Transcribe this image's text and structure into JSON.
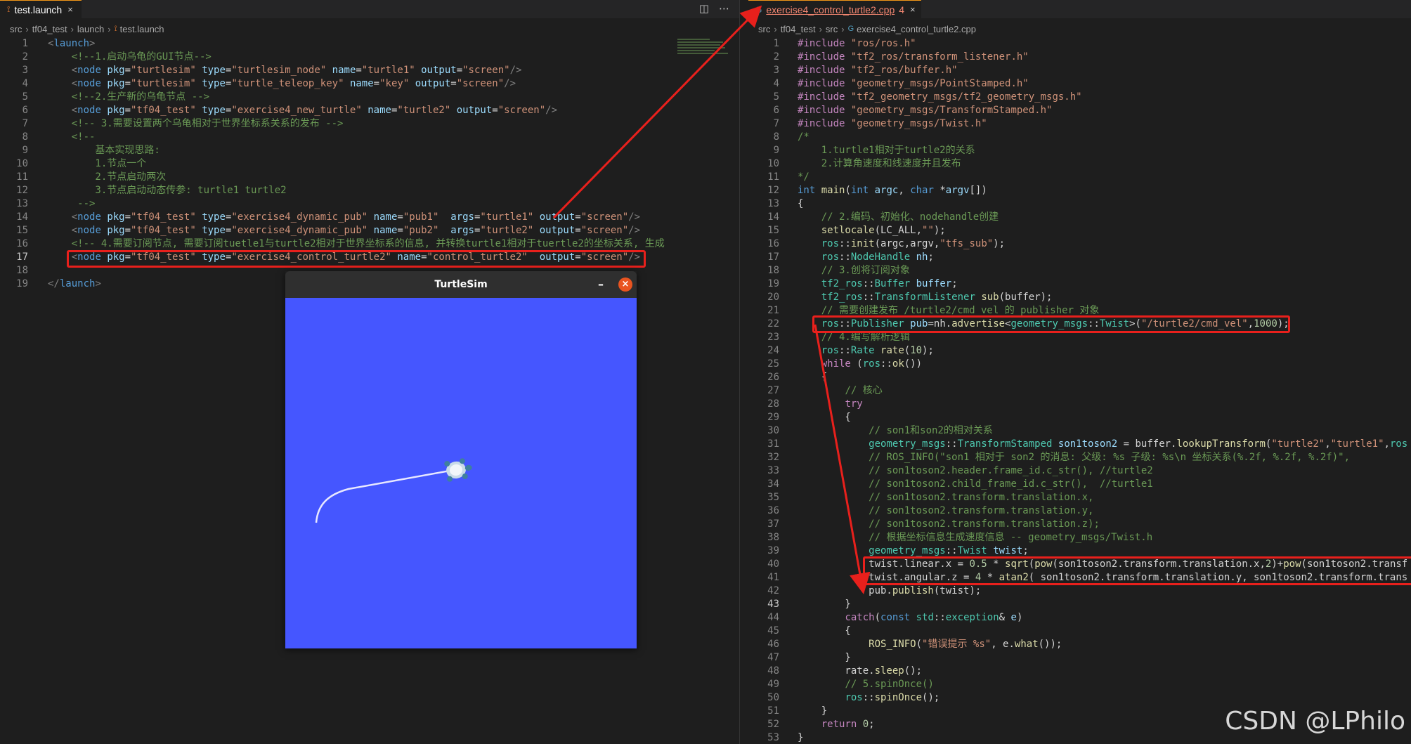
{
  "left_editor": {
    "tab": {
      "label": "test.launch",
      "close": "×"
    },
    "breadcrumb": [
      "src",
      "tf04_test",
      "launch",
      "test.launch"
    ],
    "current_line": 17,
    "lines": [
      {
        "n": 1,
        "html": "<span class='c-pun'>&lt;</span><span class='c-tag'>launch</span><span class='c-pun'>&gt;</span>"
      },
      {
        "n": 2,
        "html": "    <span class='c-com'>&lt;!--1.启动乌龟的GUI节点--&gt;</span>"
      },
      {
        "n": 3,
        "html": "    <span class='c-pun'>&lt;</span><span class='c-tag'>node</span> <span class='c-attr'>pkg</span>=<span class='c-str'>\"turtlesim\"</span> <span class='c-attr'>type</span>=<span class='c-str'>\"turtlesim_node\"</span> <span class='c-attr'>name</span>=<span class='c-str'>\"turtle1\"</span> <span class='c-attr'>output</span>=<span class='c-str'>\"screen\"</span><span class='c-pun'>/&gt;</span>"
      },
      {
        "n": 4,
        "html": "    <span class='c-pun'>&lt;</span><span class='c-tag'>node</span> <span class='c-attr'>pkg</span>=<span class='c-str'>\"turtlesim\"</span> <span class='c-attr'>type</span>=<span class='c-str'>\"turtle_teleop_key\"</span> <span class='c-attr'>name</span>=<span class='c-str'>\"key\"</span> <span class='c-attr'>output</span>=<span class='c-str'>\"screen\"</span><span class='c-pun'>/&gt;</span>"
      },
      {
        "n": 5,
        "html": "    <span class='c-com'>&lt;!--2.生产新的乌龟节点 --&gt;</span>"
      },
      {
        "n": 6,
        "html": "    <span class='c-pun'>&lt;</span><span class='c-tag'>node</span> <span class='c-attr'>pkg</span>=<span class='c-str'>\"tf04_test\"</span> <span class='c-attr'>type</span>=<span class='c-str'>\"exercise4_new_turtle\"</span> <span class='c-attr'>name</span>=<span class='c-str'>\"turtle2\"</span> <span class='c-attr'>output</span>=<span class='c-str'>\"screen\"</span><span class='c-pun'>/&gt;</span>"
      },
      {
        "n": 7,
        "html": "    <span class='c-com'>&lt;!-- 3.需要设置两个乌龟相对于世界坐标系关系的发布 --&gt;</span>"
      },
      {
        "n": 8,
        "html": "    <span class='c-com'>&lt;!--</span>"
      },
      {
        "n": 9,
        "html": "<span class='c-com'>        基本实现思路:</span>"
      },
      {
        "n": 10,
        "html": "<span class='c-com'>        1.节点一个</span>"
      },
      {
        "n": 11,
        "html": "<span class='c-com'>        2.节点启动两次</span>"
      },
      {
        "n": 12,
        "html": "<span class='c-com'>        3.节点启动动态传参: turtle1 turtle2</span>"
      },
      {
        "n": 13,
        "html": "<span class='c-com'>     --&gt;</span>"
      },
      {
        "n": 14,
        "html": "    <span class='c-pun'>&lt;</span><span class='c-tag'>node</span> <span class='c-attr'>pkg</span>=<span class='c-str'>\"tf04_test\"</span> <span class='c-attr'>type</span>=<span class='c-str'>\"exercise4_dynamic_pub\"</span> <span class='c-attr'>name</span>=<span class='c-str'>\"pub1\"</span>  <span class='c-attr'>args</span>=<span class='c-str'>\"turtle1\"</span> <span class='c-attr'>output</span>=<span class='c-str'>\"screen\"</span><span class='c-pun'>/&gt;</span>"
      },
      {
        "n": 15,
        "html": "    <span class='c-pun'>&lt;</span><span class='c-tag'>node</span> <span class='c-attr'>pkg</span>=<span class='c-str'>\"tf04_test\"</span> <span class='c-attr'>type</span>=<span class='c-str'>\"exercise4_dynamic_pub\"</span> <span class='c-attr'>name</span>=<span class='c-str'>\"pub2\"</span>  <span class='c-attr'>args</span>=<span class='c-str'>\"turtle2\"</span> <span class='c-attr'>output</span>=<span class='c-str'>\"screen\"</span><span class='c-pun'>/&gt;</span>"
      },
      {
        "n": 16,
        "html": "    <span class='c-com'>&lt;!-- 4.需要订阅节点, 需要订阅tuetle1与turtle2相对于世界坐标系的信息, 并转换turtle1相对于tuertle2的坐标关系, 生成</span>"
      },
      {
        "n": 17,
        "html": "    <span class='c-pun'>&lt;</span><span class='c-tag'>node</span> <span class='c-attr'>pkg</span>=<span class='c-str'>\"tf04_test\"</span> <span class='c-attr'>type</span>=<span class='c-str'>\"exercise4_control_turtle2\"</span> <span class='c-attr'>name</span>=<span class='c-str'>\"control_turtle2\"</span>  <span class='c-attr'>output</span>=<span class='c-str'>\"screen\"</span><span class='c-pun'>/&gt;</span>"
      },
      {
        "n": 18,
        "html": ""
      },
      {
        "n": 19,
        "html": "<span class='c-pun'>&lt;/</span><span class='c-tag'>launch</span><span class='c-pun'>&gt;</span>"
      }
    ]
  },
  "right_editor": {
    "tab": {
      "label": "exercise4_control_turtle2.cpp",
      "problems": "4",
      "close": "×"
    },
    "breadcrumb": [
      "src",
      "tf04_test",
      "src",
      "exercise4_control_turtle2.cpp"
    ],
    "current_line": 43,
    "lines": [
      {
        "n": 1,
        "html": "<span class='c-kw2'>#include</span> <span class='c-str'>\"ros/ros.h\"</span>"
      },
      {
        "n": 2,
        "html": "<span class='c-kw2'>#include</span> <span class='c-str'>\"tf2_ros/transform_listener.h\"</span>"
      },
      {
        "n": 3,
        "html": "<span class='c-kw2'>#include</span> <span class='c-str'>\"tf2_ros/buffer.h\"</span>"
      },
      {
        "n": 4,
        "html": "<span class='c-kw2'>#include</span> <span class='c-str'>\"geometry_msgs/PointStamped.h\"</span>"
      },
      {
        "n": 5,
        "html": "<span class='c-kw2'>#include</span> <span class='c-str'>\"tf2_geometry_msgs/tf2_geometry_msgs.h\"</span>"
      },
      {
        "n": 6,
        "html": "<span class='c-kw2'>#include</span> <span class='c-str'>\"geometry_msgs/TransformStamped.h\"</span>"
      },
      {
        "n": 7,
        "html": "<span class='c-kw2'>#include</span> <span class='c-str'>\"geometry_msgs/Twist.h\"</span>"
      },
      {
        "n": 8,
        "html": "<span class='c-com'>/*</span>"
      },
      {
        "n": 9,
        "html": "<span class='c-com'>    1.turtle1相对于turtle2的关系</span>"
      },
      {
        "n": 10,
        "html": "<span class='c-com'>    2.计算角速度和线速度并且发布</span>"
      },
      {
        "n": 11,
        "html": "<span class='c-com'>*/</span>"
      },
      {
        "n": 12,
        "html": "<span class='c-kw'>int</span> <span class='c-fn'>main</span>(<span class='c-kw'>int</span> <span class='c-var'>argc</span>, <span class='c-kw'>char</span> *<span class='c-var'>argv</span>[])"
      },
      {
        "n": 13,
        "html": "{"
      },
      {
        "n": 14,
        "html": "    <span class='c-com'>// 2.编码、初始化、nodehandle创建</span>"
      },
      {
        "n": 15,
        "html": "    <span class='c-fn'>setlocale</span>(LC_ALL,<span class='c-str'>\"\"</span>);"
      },
      {
        "n": 16,
        "html": "    <span class='c-ty'>ros</span>::<span class='c-fn'>init</span>(argc,argv,<span class='c-str'>\"tfs_sub\"</span>);"
      },
      {
        "n": 17,
        "html": "    <span class='c-ty'>ros</span>::<span class='c-ty'>NodeHandle</span> <span class='c-var'>nh</span>;"
      },
      {
        "n": 18,
        "html": "    <span class='c-com'>// 3.创将订阅对象</span>"
      },
      {
        "n": 19,
        "html": "    <span class='c-ty'>tf2_ros</span>::<span class='c-ty'>Buffer</span> <span class='c-var'>buffer</span>;"
      },
      {
        "n": 20,
        "html": "    <span class='c-ty'>tf2_ros</span>::<span class='c-ty'>TransformListener</span> <span class='c-fn'>sub</span>(buffer);"
      },
      {
        "n": 21,
        "html": "    <span class='c-com'>// 需要创建发布 /turtle2/cmd_vel 的 publisher 对象</span>"
      },
      {
        "n": 22,
        "html": "    <span class='c-ty'>ros</span>::<span class='c-ty'>Publisher</span> <span class='c-var'>pub</span>=nh.<span class='c-fn'>advertise</span>&lt;<span class='c-ty'>geometry_msgs</span>::<span class='c-ty'>Twist</span>&gt;(<span class='c-str'>\"/turtle2/cmd_vel\"</span>,<span class='c-num'>1000</span>);"
      },
      {
        "n": 23,
        "html": "    <span class='c-com'>// 4.编写解析逻辑</span>"
      },
      {
        "n": 24,
        "html": "    <span class='c-ty'>ros</span>::<span class='c-ty'>Rate</span> <span class='c-fn'>rate</span>(<span class='c-num'>10</span>);"
      },
      {
        "n": 25,
        "html": "    <span class='c-kw2'>while</span> (<span class='c-ty'>ros</span>::<span class='c-fn'>ok</span>())"
      },
      {
        "n": 26,
        "html": "    {"
      },
      {
        "n": 27,
        "html": "        <span class='c-com'>// 核心</span>"
      },
      {
        "n": 28,
        "html": "        <span class='c-kw2'>try</span>"
      },
      {
        "n": 29,
        "html": "        {"
      },
      {
        "n": 30,
        "html": "            <span class='c-com'>// son1和son2的相对关系</span>"
      },
      {
        "n": 31,
        "html": "            <span class='c-ty'>geometry_msgs</span>::<span class='c-ty'>TransformStamped</span> <span class='c-var'>son1toson2</span> = buffer.<span class='c-fn'>lookupTransform</span>(<span class='c-str'>\"turtle2\"</span>,<span class='c-str'>\"turtle1\"</span>,<span class='c-ty'>ros</span>"
      },
      {
        "n": 32,
        "html": "            <span class='c-com'>// ROS_INFO(\"son1 相对于 son2 的消息: 父级: %s 子级: %s\\n 坐标关系(%.2f, %.2f, %.2f)\",</span>"
      },
      {
        "n": 33,
        "html": "            <span class='c-com'>// son1toson2.header.frame_id.c_str(), //turtle2</span>"
      },
      {
        "n": 34,
        "html": "            <span class='c-com'>// son1toson2.child_frame_id.c_str(),  //turtle1</span>"
      },
      {
        "n": 35,
        "html": "            <span class='c-com'>// son1toson2.transform.translation.x,</span>"
      },
      {
        "n": 36,
        "html": "            <span class='c-com'>// son1toson2.transform.translation.y,</span>"
      },
      {
        "n": 37,
        "html": "            <span class='c-com'>// son1toson2.transform.translation.z);</span>"
      },
      {
        "n": 38,
        "html": "            <span class='c-com'>// 根据坐标信息生成速度信息 -- geometry_msgs/Twist.h</span>"
      },
      {
        "n": 39,
        "html": "            <span class='c-ty'>geometry_msgs</span>::<span class='c-ty'>Twist</span> <span class='c-var'>twist</span>;"
      },
      {
        "n": 40,
        "html": "            twist.linear.x = <span class='c-num'>0.5</span> * <span class='c-fn'>sqrt</span>(<span class='c-fn'>pow</span>(son1toson2.transform.translation.x,<span class='c-num'>2</span>)+<span class='c-fn'>pow</span>(son1toson2.transf"
      },
      {
        "n": 41,
        "html": "            twist.angular.z = <span class='c-num'>4</span> * <span class='c-fn'>atan2</span>( son1toson2.transform.translation.y, son1toson2.transform.trans"
      },
      {
        "n": 42,
        "html": "            pub.<span class='c-fn'>publish</span>(twist);"
      },
      {
        "n": 43,
        "html": "        }"
      },
      {
        "n": 44,
        "html": "        <span class='c-kw2'>catch</span>(<span class='c-kw'>const</span> <span class='c-ty'>std</span>::<span class='c-ty'>exception</span>&amp; <span class='c-var'>e</span>)"
      },
      {
        "n": 45,
        "html": "        {"
      },
      {
        "n": 46,
        "html": "            <span class='c-fn'>ROS_INFO</span>(<span class='c-str'>\"错误提示 %s\"</span>, e.<span class='c-fn'>what</span>());"
      },
      {
        "n": 47,
        "html": "        }"
      },
      {
        "n": 48,
        "html": "        rate.<span class='c-fn'>sleep</span>();"
      },
      {
        "n": 49,
        "html": "        <span class='c-com'>// 5.spinOnce()</span>"
      },
      {
        "n": 50,
        "html": "        <span class='c-ty'>ros</span>::<span class='c-fn'>spinOnce</span>();"
      },
      {
        "n": 51,
        "html": "    }"
      },
      {
        "n": 52,
        "html": "    <span class='c-kw2'>return</span> <span class='c-num'>0</span>;"
      },
      {
        "n": 53,
        "html": "}"
      }
    ]
  },
  "turtlesim": {
    "title": "TurtleSim",
    "minimize": "–",
    "close": "×",
    "background": "#4556ff"
  },
  "annotation_color": "#e8201c",
  "watermark": "CSDN @LPhilo"
}
